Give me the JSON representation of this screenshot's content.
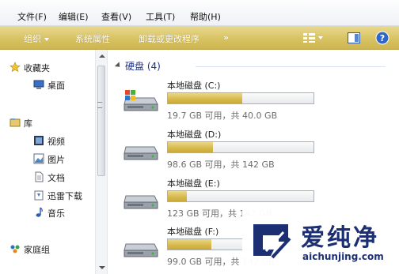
{
  "menu": {
    "file": "文件(F)",
    "edit": "编辑(E)",
    "view": "查看(V)",
    "tools": "工具(T)",
    "help": "帮助(H)"
  },
  "toolbar": {
    "organize": "组织",
    "properties": "系统属性",
    "uninstall": "卸载或更改程序",
    "more": "»"
  },
  "nav": {
    "favorites": "收藏夹",
    "desktop": "桌面",
    "libraries": "库",
    "videos": "视频",
    "pictures": "图片",
    "documents": "文档",
    "thunder": "迅雷下载",
    "music": "音乐",
    "homegroup": "家庭组"
  },
  "content": {
    "group_title": "硬盘 (4)",
    "drives": [
      {
        "name": "本地磁盘 (C:)",
        "free_text": "19.7 GB 可用，共 40.0 GB",
        "used_fraction": 0.51,
        "icon": "windows-drive-icon"
      },
      {
        "name": "本地磁盘 (D:)",
        "free_text": "98.6 GB 可用，共 142 GB",
        "used_fraction": 0.31,
        "icon": "hard-drive-icon"
      },
      {
        "name": "本地磁盘 (E:)",
        "free_text": "123 GB 可用，共 142 GB",
        "used_fraction": 0.13,
        "icon": "hard-drive-icon"
      },
      {
        "name": "本地磁盘 (F:)",
        "free_text": "99.0 GB 可用，共 142 GB",
        "used_fraction": 0.3,
        "icon": "hard-drive-icon"
      }
    ]
  },
  "watermark": {
    "title": "爱纯净",
    "url": "aichunjing.com"
  },
  "colors": {
    "toolbar": "#d8c363",
    "bar_fill": "#d6b84b",
    "group_header": "#1e3287",
    "watermark": "#1d2f73"
  }
}
